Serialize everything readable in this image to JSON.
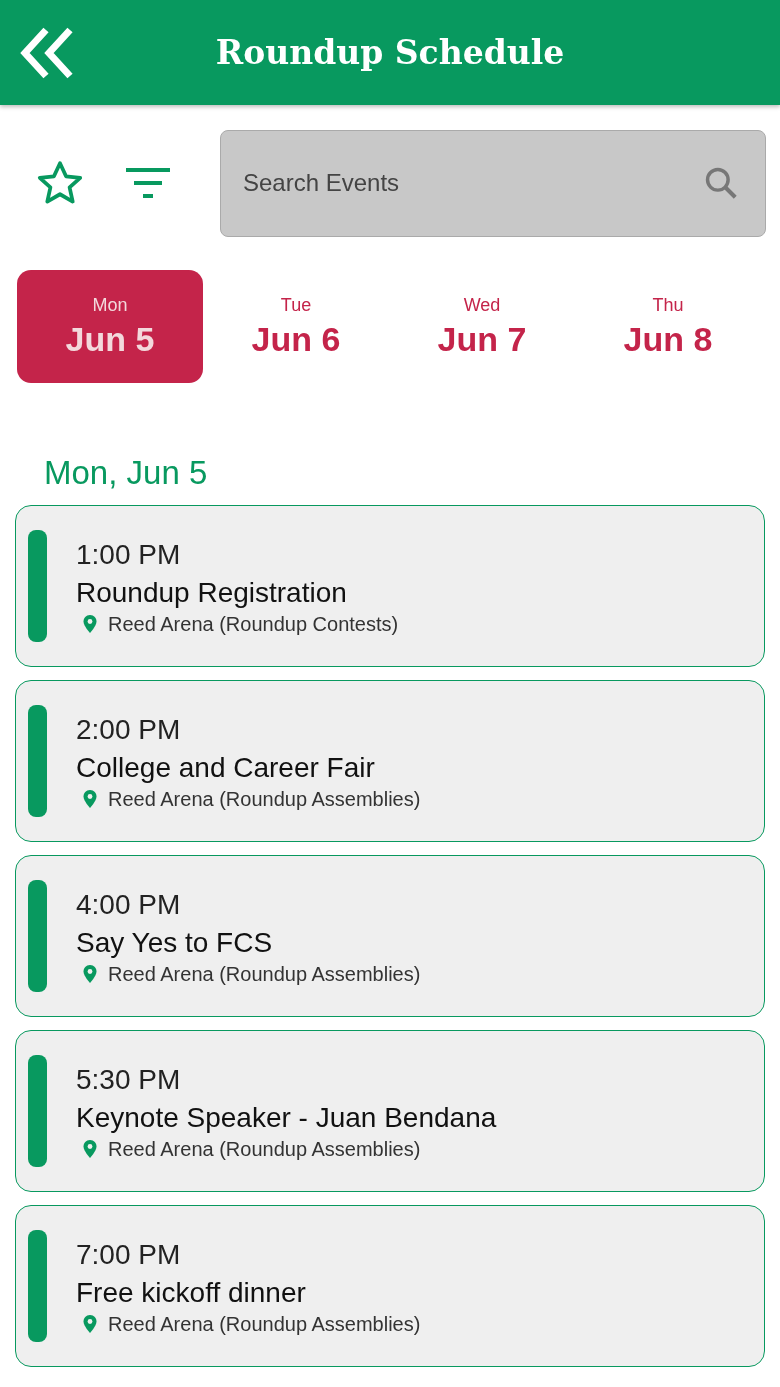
{
  "header": {
    "title": "Roundup Schedule"
  },
  "toolbar": {
    "favorites_selected": false,
    "search": {
      "placeholder": "Search Events"
    }
  },
  "days": [
    {
      "weekday": "Mon",
      "date": "Jun 5",
      "selected": true
    },
    {
      "weekday": "Tue",
      "date": "Jun 6",
      "selected": false
    },
    {
      "weekday": "Wed",
      "date": "Jun 7",
      "selected": false
    },
    {
      "weekday": "Thu",
      "date": "Jun 8",
      "selected": false
    }
  ],
  "section_title": "Mon, Jun 5",
  "events": [
    {
      "time": "1:00 PM",
      "title": "Roundup Registration",
      "location": "Reed Arena (Roundup Contests)"
    },
    {
      "time": "2:00 PM",
      "title": "College and Career Fair",
      "location": "Reed Arena (Roundup Assemblies)"
    },
    {
      "time": "4:00 PM",
      "title": "Say Yes to FCS",
      "location": "Reed Arena (Roundup Assemblies)"
    },
    {
      "time": "5:30 PM",
      "title": "Keynote Speaker - Juan Bendana",
      "location": "Reed Arena (Roundup Assemblies)"
    },
    {
      "time": "7:00 PM",
      "title": "Free kickoff dinner",
      "location": "Reed Arena (Roundup Assemblies)"
    }
  ]
}
